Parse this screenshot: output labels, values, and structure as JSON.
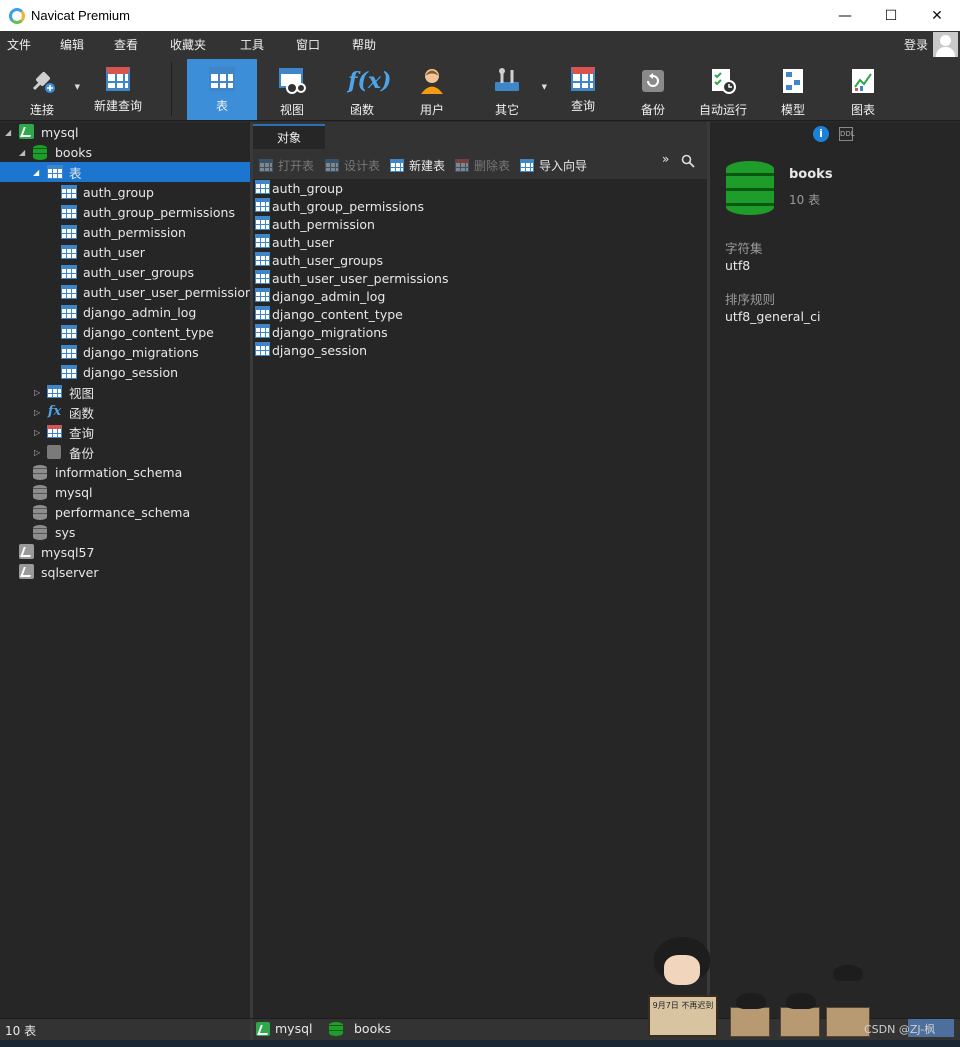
{
  "window": {
    "title": "Navicat Premium",
    "controls": {
      "minimize": "—",
      "maximize": "☐",
      "close": "✕"
    }
  },
  "menubar": {
    "items": [
      "文件",
      "编辑",
      "查看",
      "收藏夹",
      "工具",
      "窗口",
      "帮助"
    ],
    "login": "登录"
  },
  "toolbar": {
    "connect": "连接",
    "new_query": "新建查询",
    "table": "表",
    "view": "视图",
    "function": "函数",
    "user": "用户",
    "other": "其它",
    "query": "查询",
    "backup": "备份",
    "autorun": "自动运行",
    "model": "模型",
    "chart": "图表"
  },
  "tree": {
    "conn_mysql": "mysql",
    "db_books": "books",
    "node_tables": "表",
    "tables": [
      "auth_group",
      "auth_group_permissions",
      "auth_permission",
      "auth_user",
      "auth_user_groups",
      "auth_user_user_permissions",
      "django_admin_log",
      "django_content_type",
      "django_migrations",
      "django_session"
    ],
    "node_views": "视图",
    "node_functions": "函数",
    "node_queries": "查询",
    "node_backups": "备份",
    "other_dbs": [
      "information_schema",
      "mysql",
      "performance_schema",
      "sys"
    ],
    "conn_mysql57": "mysql57",
    "conn_sqlserver": "sqlserver"
  },
  "objects": {
    "tab": "对象",
    "open_table": "打开表",
    "design_table": "设计表",
    "new_table": "新建表",
    "delete_table": "删除表",
    "import_wizard": "导入向导",
    "more": "»",
    "rows": [
      "auth_group",
      "auth_group_permissions",
      "auth_permission",
      "auth_user",
      "auth_user_groups",
      "auth_user_user_permissions",
      "django_admin_log",
      "django_content_type",
      "django_migrations",
      "django_session"
    ]
  },
  "info": {
    "name": "books",
    "table_count": "10 表",
    "charset_label": "字符集",
    "charset": "utf8",
    "collation_label": "排序规则",
    "collation": "utf8_general_ci"
  },
  "status": {
    "count": "10 表",
    "connection": "mysql",
    "database": "books"
  },
  "overlay": {
    "sticker_text": "9月7日 不再迟到",
    "watermark": "CSDN @ZJ-枫"
  },
  "colors": {
    "accent": "#3d8ed8",
    "selection": "#1c76d0",
    "db_green": "#1e9d2a"
  }
}
